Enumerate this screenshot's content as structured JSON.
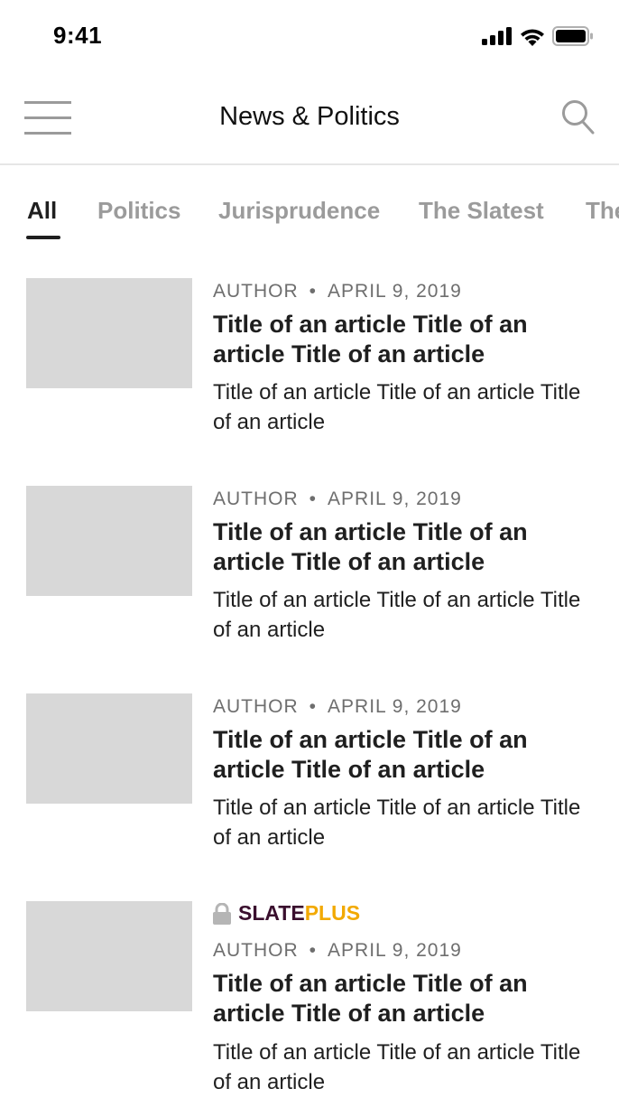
{
  "status_bar": {
    "time": "9:41",
    "icons": [
      "signal-icon",
      "wifi-icon",
      "battery-icon"
    ]
  },
  "nav": {
    "title": "News & Politics",
    "menu_icon": "hamburger-menu-icon",
    "search_icon": "search-icon"
  },
  "tabs": [
    {
      "label": "All",
      "active": true
    },
    {
      "label": "Politics",
      "active": false
    },
    {
      "label": "Jurisprudence",
      "active": false
    },
    {
      "label": "The Slatest",
      "active": false
    },
    {
      "label": "The",
      "active": false
    }
  ],
  "articles": [
    {
      "author": "AUTHOR",
      "separator": "•",
      "date": "APRIL 9, 2019",
      "title": "Title of an article Title of an article Title of an article",
      "description": "Title of an article Title of an article Title of an article"
    },
    {
      "author": "AUTHOR",
      "separator": "•",
      "date": "APRIL 9, 2019",
      "title": "Title of an article Title of an article Title of an article",
      "description": "Title of an article Title of an article Title of an article"
    },
    {
      "author": "AUTHOR",
      "separator": "•",
      "date": "APRIL 9, 2019",
      "title": "Title of an article Title of an article Title of an article",
      "description": "Title of an article Title of an article Title of an article"
    },
    {
      "badge": {
        "icon": "lock-icon",
        "brand_part1": "SLATE",
        "brand_part2": "PLUS"
      },
      "author": "AUTHOR",
      "separator": "•",
      "date": "APRIL 9, 2019",
      "title": "Title of an article Title of an article Title of an article",
      "description": "Title of an article Title of an article Title of an article"
    }
  ],
  "colors": {
    "active_tab": "#1f1f1f",
    "inactive_tab": "#9b9b9b",
    "thumbnail_placeholder": "#d8d8d8",
    "slate_brand": "#3a0f2e",
    "plus_brand": "#f2a900"
  }
}
